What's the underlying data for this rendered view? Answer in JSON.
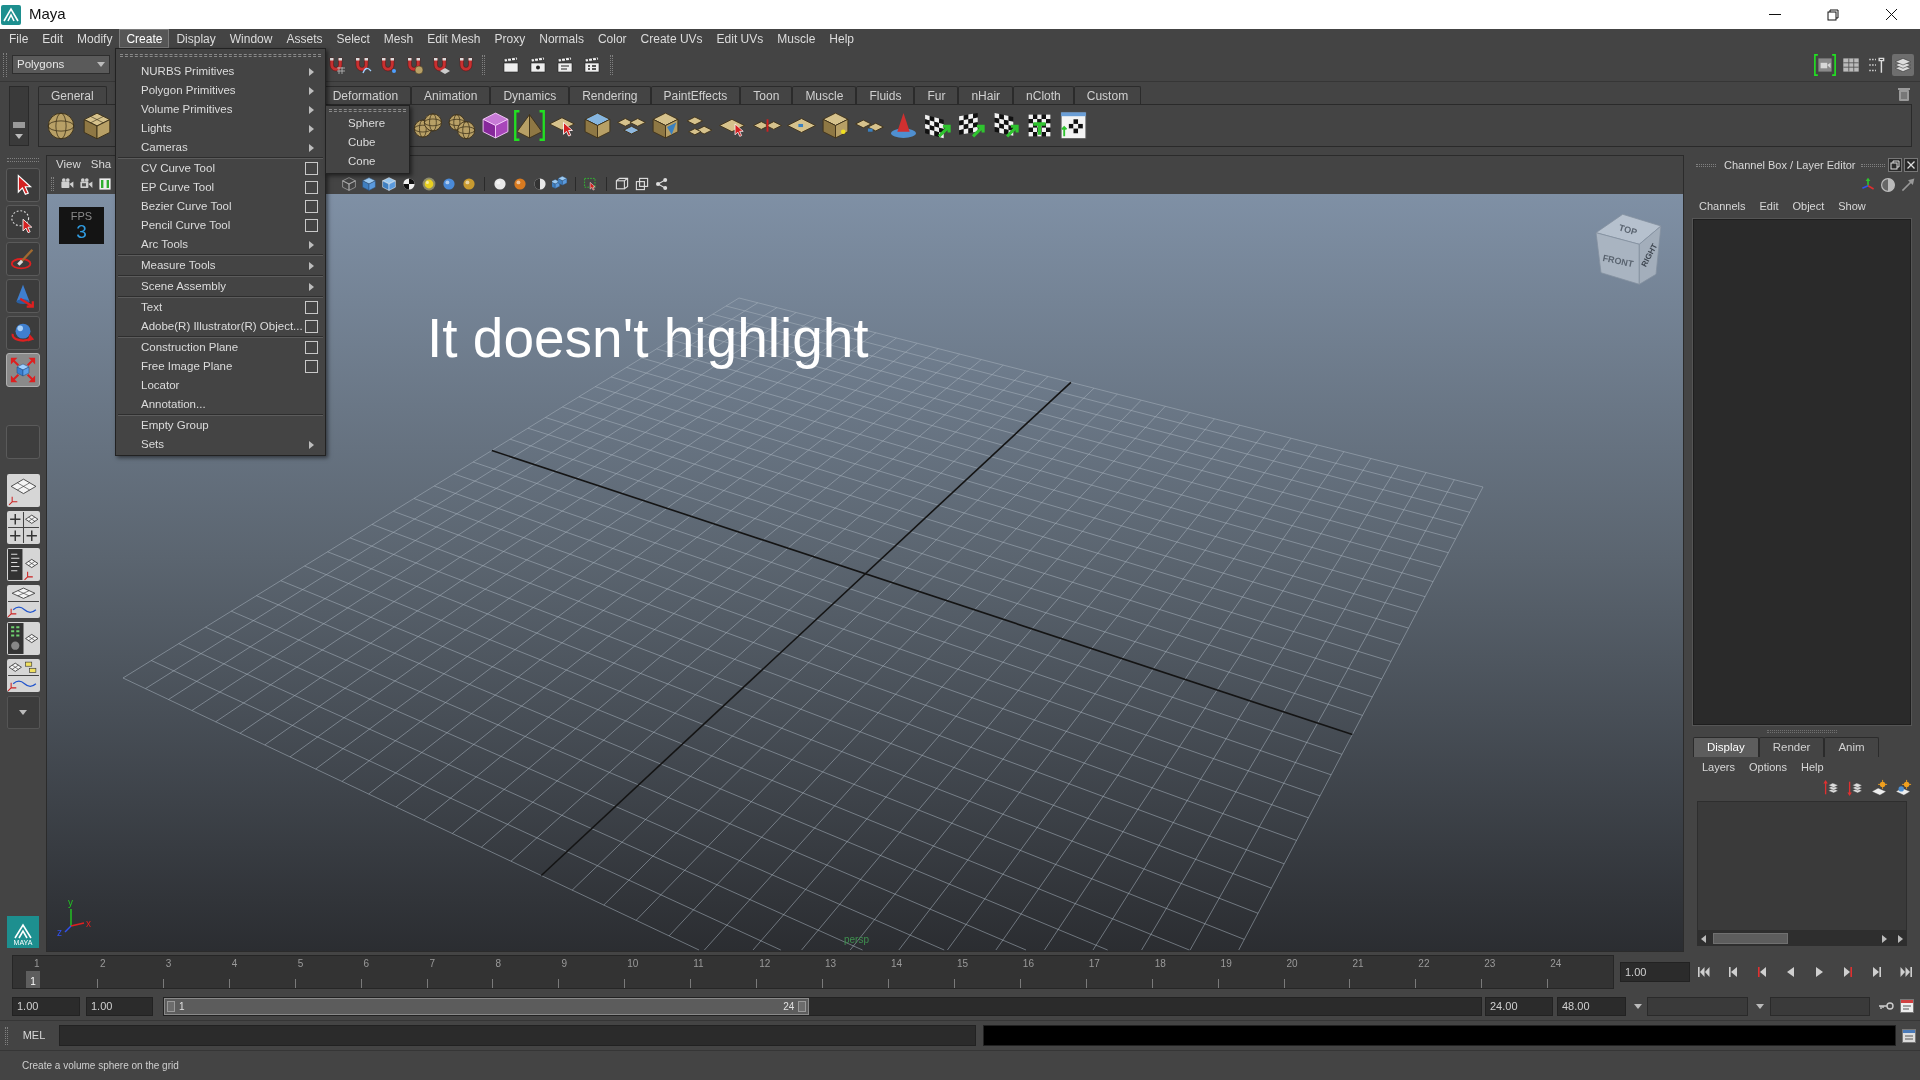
{
  "window": {
    "title": "Maya"
  },
  "menu_bar": [
    {
      "label": "File",
      "selected": false
    },
    {
      "label": "Edit",
      "selected": false
    },
    {
      "label": "Modify",
      "selected": false
    },
    {
      "label": "Create",
      "selected": true
    },
    {
      "label": "Display",
      "selected": false
    },
    {
      "label": "Window",
      "selected": false
    },
    {
      "label": "Assets",
      "selected": false
    },
    {
      "label": "Select",
      "selected": false
    },
    {
      "label": "Mesh",
      "selected": false
    },
    {
      "label": "Edit Mesh",
      "selected": false
    },
    {
      "label": "Proxy",
      "selected": false
    },
    {
      "label": "Normals",
      "selected": false
    },
    {
      "label": "Color",
      "selected": false
    },
    {
      "label": "Create UVs",
      "selected": false
    },
    {
      "label": "Edit UVs",
      "selected": false
    },
    {
      "label": "Muscle",
      "selected": false
    },
    {
      "label": "Help",
      "selected": false
    }
  ],
  "create_menu": {
    "groups": [
      [
        {
          "label": "NURBS Primitives",
          "kind": "submenu"
        },
        {
          "label": "Polygon Primitives",
          "kind": "submenu"
        },
        {
          "label": "Volume Primitives",
          "kind": "submenu",
          "submenu": [
            "Sphere",
            "Cube",
            "Cone"
          ]
        },
        {
          "label": "Lights",
          "kind": "submenu"
        },
        {
          "label": "Cameras",
          "kind": "submenu"
        }
      ],
      [
        {
          "label": "CV Curve Tool",
          "kind": "option"
        },
        {
          "label": "EP Curve Tool",
          "kind": "option"
        },
        {
          "label": "Bezier Curve Tool",
          "kind": "option"
        },
        {
          "label": "Pencil Curve Tool",
          "kind": "option"
        },
        {
          "label": "Arc Tools",
          "kind": "submenu"
        }
      ],
      [
        {
          "label": "Measure Tools",
          "kind": "submenu"
        }
      ],
      [
        {
          "label": "Scene Assembly",
          "kind": "submenu"
        }
      ],
      [
        {
          "label": "Text",
          "kind": "option"
        },
        {
          "label": "Adobe(R) Illustrator(R) Object...",
          "kind": "option"
        }
      ],
      [
        {
          "label": "Construction Plane",
          "kind": "option"
        },
        {
          "label": "Free Image Plane",
          "kind": "option"
        },
        {
          "label": "Locator",
          "kind": "plain"
        },
        {
          "label": "Annotation...",
          "kind": "plain"
        }
      ],
      [
        {
          "label": "Empty Group",
          "kind": "plain"
        },
        {
          "label": "Sets",
          "kind": "submenu"
        }
      ]
    ]
  },
  "status_line": {
    "mode": "Polygons",
    "right_buttons": [
      {
        "selected": true,
        "on": false
      },
      {
        "selected": false,
        "on": false
      },
      {
        "selected": false,
        "on": false
      },
      {
        "selected": false,
        "on": true
      }
    ]
  },
  "shelf": {
    "tabs_left": [
      {
        "label": "General",
        "selected": false
      }
    ],
    "tabs_right": [
      {
        "label": "Deformation",
        "selected": false
      },
      {
        "label": "Animation",
        "selected": false
      },
      {
        "label": "Dynamics",
        "selected": false
      },
      {
        "label": "Rendering",
        "selected": false
      },
      {
        "label": "PaintEffects",
        "selected": false
      },
      {
        "label": "Toon",
        "selected": false
      },
      {
        "label": "Muscle",
        "selected": false
      },
      {
        "label": "Fluids",
        "selected": false
      },
      {
        "label": "Fur",
        "selected": false
      },
      {
        "label": "nHair",
        "selected": false
      },
      {
        "label": "nCloth",
        "selected": false
      },
      {
        "label": "Custom",
        "selected": false
      }
    ],
    "left_buttons": [
      {
        "selected": false
      },
      {
        "selected": false
      }
    ],
    "right_buttons": [
      {
        "selected": false
      },
      {
        "selected": false
      },
      {
        "selected": false
      },
      {
        "selected": true
      },
      {
        "selected": false
      },
      {
        "selected": false
      },
      {
        "selected": false
      },
      {
        "selected": false
      },
      {
        "selected": false
      },
      {
        "selected": false
      },
      {
        "selected": false
      },
      {
        "selected": false
      },
      {
        "selected": false
      },
      {
        "selected": false
      },
      {
        "selected": false
      },
      {
        "selected": false
      },
      {
        "selected": false
      },
      {
        "selected": false
      },
      {
        "selected": false
      },
      {
        "selected": false
      }
    ]
  },
  "toolbox": {
    "tools": [
      {
        "selected": false
      },
      {
        "selected": false
      },
      {
        "selected": false
      },
      {
        "selected": false
      },
      {
        "selected": false
      },
      {
        "selected": true
      }
    ],
    "logo_caption": "MAYA"
  },
  "viewport": {
    "menu": [
      "View",
      "Sha"
    ],
    "fps_label": "FPS",
    "fps_value": "3",
    "annotation": "It doesn't highlight",
    "view_cube": {
      "top": "TOP",
      "front": "FRONT",
      "right": "RIGHT"
    },
    "axes": {
      "x": "x",
      "y": "y",
      "z": "z"
    },
    "camera": "persp"
  },
  "channel_box": {
    "title": "Channel Box / Layer Editor",
    "menu": [
      "Channels",
      "Edit",
      "Object",
      "Show"
    ]
  },
  "layer_editor": {
    "tabs": [
      {
        "label": "Display",
        "selected": true
      },
      {
        "label": "Render",
        "selected": false
      },
      {
        "label": "Anim",
        "selected": false
      }
    ],
    "menu": [
      "Layers",
      "Options",
      "Help"
    ]
  },
  "time_slider": {
    "frames": [
      {
        "label": "1",
        "selected": true
      },
      {
        "label": "2",
        "selected": false
      },
      {
        "label": "3",
        "selected": false
      },
      {
        "label": "4",
        "selected": false
      },
      {
        "label": "5",
        "selected": false
      },
      {
        "label": "6",
        "selected": false
      },
      {
        "label": "7",
        "selected": false
      },
      {
        "label": "8",
        "selected": false
      },
      {
        "label": "9",
        "selected": false
      },
      {
        "label": "10",
        "selected": false
      },
      {
        "label": "11",
        "selected": false
      },
      {
        "label": "12",
        "selected": false
      },
      {
        "label": "13",
        "selected": false
      },
      {
        "label": "14",
        "selected": false
      },
      {
        "label": "15",
        "selected": false
      },
      {
        "label": "16",
        "selected": false
      },
      {
        "label": "17",
        "selected": false
      },
      {
        "label": "18",
        "selected": false
      },
      {
        "label": "19",
        "selected": false
      },
      {
        "label": "20",
        "selected": false
      },
      {
        "label": "21",
        "selected": false
      },
      {
        "label": "22",
        "selected": false
      },
      {
        "label": "23",
        "selected": false
      },
      {
        "label": "24",
        "selected": false
      }
    ],
    "current_frame": "1",
    "current_time": "1.00"
  },
  "range_slider": {
    "start": "1.00",
    "playback_start": "1.00",
    "range_start": "1",
    "range_end": "24",
    "level": 0.49,
    "playback_end": "24.00",
    "end": "48.00"
  },
  "command_line": {
    "language": "MEL"
  },
  "help_line": "Create a volume sphere on the grid"
}
